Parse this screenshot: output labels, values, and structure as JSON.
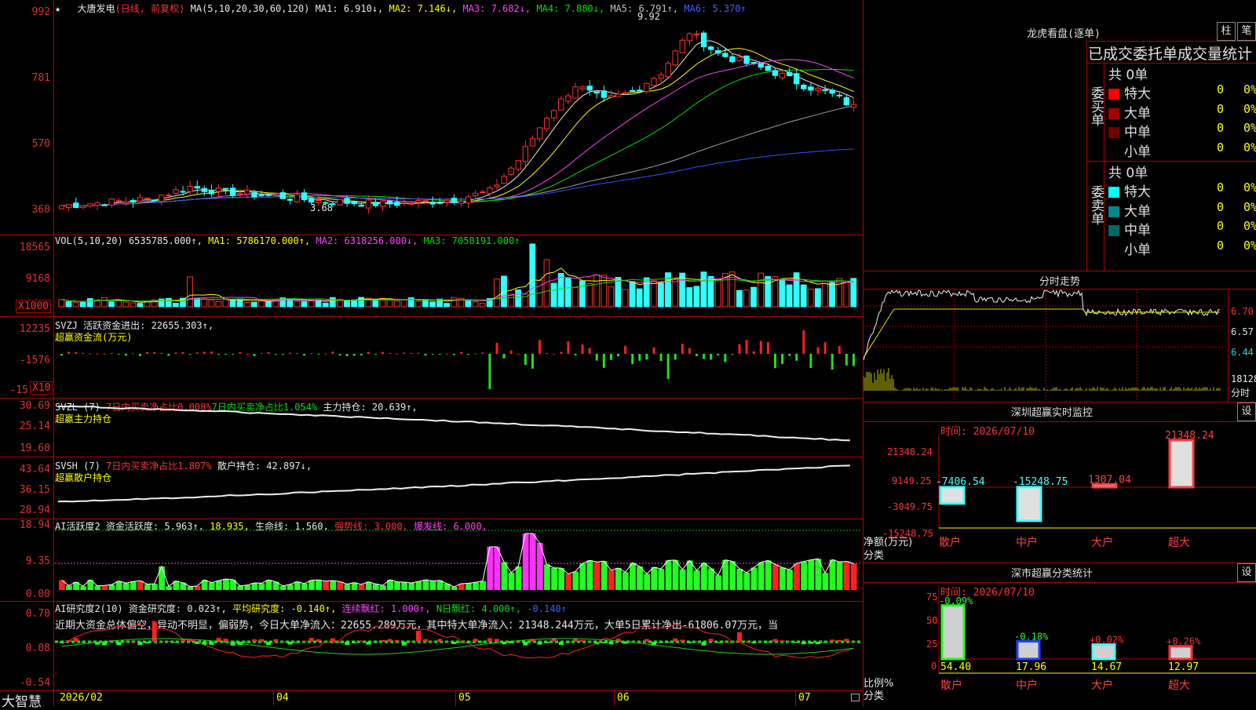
{
  "kline": {
    "title_star": "★",
    "stock_name": "大唐发电",
    "period": "(日线, 前复权)",
    "ma_header": "MA(5,10,20,30,60,120)",
    "ma1": "MA1: 6.910↓,",
    "ma2": "MA2: 7.146↓,",
    "ma3": "MA3: 7.682↓,",
    "ma4": "MA4: 7.880↓,",
    "ma5": "MA5: 6.791↑,",
    "ma6": "MA6: 5.370↑",
    "y_ticks": [
      "992",
      "781",
      "570",
      "360"
    ],
    "high_marker": "9.92",
    "low_marker": "3.68"
  },
  "volume": {
    "header": "VOL(5,10,20)",
    "value": "6535785.000↑,",
    "ma1": "MA1: 5786170.000↑,",
    "ma2": "MA2: 6318256.000↓,",
    "ma3": "MA3: 7058191.000↑",
    "y_ticks": [
      "18565",
      "9168"
    ],
    "unit": "X1000"
  },
  "svzj": {
    "line1": "SVZJ  活跃资金进出: 22655.303↑,",
    "line2": "超赢资金流(万元)",
    "y_ticks": [
      "12235",
      "-1576",
      "-15"
    ],
    "unit": "X10"
  },
  "svzl": {
    "header": "SVZL (7)",
    "seg1": "7日内买卖净占比0.008%",
    "seg2": "7日内买卖净占比1.054%",
    "seg3": "主力持仓: 20.639↑,",
    "line2": "超赢主力持仓",
    "y_ticks": [
      "30.69",
      "25.14",
      "19.60"
    ]
  },
  "svsh": {
    "header": "SVSH (7)",
    "seg1": "7日内买卖净占比1.807%",
    "seg2": "散户持仓: 42.897↓,",
    "line2": "超赢散户持仓",
    "y_ticks": [
      "43.64",
      "36.15",
      "28.94"
    ]
  },
  "ai_active": {
    "header": "AI活跃度2",
    "seg1": "资金活跃度: 5.963↑,",
    "seg2": "18.935,",
    "seg3": "生命线: 1.560,",
    "seg4": "强势线: 3.000,",
    "seg5": "爆发线: 6.000,",
    "y_ticks": [
      "18.94",
      "9.35",
      "0.00"
    ]
  },
  "ai_research": {
    "header": "AI研究度2(10)",
    "seg1": "资金研究度: 0.023↑,",
    "seg2": "平均研究度: -0.140↑,",
    "seg3": "连续飘红: 1.000↑,",
    "seg4": "N日飘红: 4.000↑,",
    "seg5": "-0.140↑",
    "summary": "近期大资金总体偏空，异动不明显，偏弱势，今日大单净流入：22655.289万元，其中特大单净流入：21348.244万元，大单5日累计净出-61806.07万元，当",
    "y_ticks": [
      "0.70",
      "0.08",
      "-0.54"
    ]
  },
  "bottom_axis": {
    "brand": "大智慧",
    "dates": [
      "2026/02",
      "04",
      "05",
      "06",
      "07"
    ]
  },
  "dragon_tiger": {
    "title": "龙虎看盘(逐单)",
    "btn1": "柱",
    "btn2": "笔",
    "subtitle": "已成交委托单成交量统计",
    "buy_label": "委买单",
    "sell_label": "委卖单",
    "buy_total": "共 0单",
    "sell_total": "共 0单",
    "buy_rows": [
      {
        "name": "特大",
        "count": "0",
        "pct": "0%",
        "color": "#ff0000"
      },
      {
        "name": "大单",
        "count": "0",
        "pct": "0%",
        "color": "#a00000"
      },
      {
        "name": "中单",
        "count": "0",
        "pct": "0%",
        "color": "#700000"
      },
      {
        "name": "小单",
        "count": "0",
        "pct": "0%",
        "color": "#000000"
      }
    ],
    "sell_rows": [
      {
        "name": "特大",
        "count": "0",
        "pct": "0%",
        "color": "#00ffff"
      },
      {
        "name": "大单",
        "count": "0",
        "pct": "0%",
        "color": "#008888"
      },
      {
        "name": "中单",
        "count": "0",
        "pct": "0%",
        "color": "#006666"
      },
      {
        "name": "小单",
        "count": "0",
        "pct": "0%",
        "color": "#000000"
      }
    ]
  },
  "intraday": {
    "title": "分时走势",
    "y_ticks": [
      "6.70",
      "6.57",
      "6.44"
    ],
    "vol_tick": "18128",
    "vol_label": "分时"
  },
  "monitor": {
    "title": "深圳超赢实时监控",
    "settings": "设",
    "time": "时间: 2026/07/10",
    "y_ticks": [
      "21348.24",
      "9149.25",
      "-3049.75",
      "-15248.75"
    ],
    "bars": [
      {
        "label": "散户",
        "value": "-7406.54"
      },
      {
        "label": "中户",
        "value": "-15248.75"
      },
      {
        "label": "大户",
        "value": "1307.04"
      },
      {
        "label": "超大",
        "value": "21348.24"
      }
    ],
    "y_title": "净额(万元)",
    "x_title": "分类"
  },
  "classify": {
    "title": "深市超赢分类统计",
    "settings": "设",
    "time": "时间: 2026/07/10",
    "y_ticks": [
      "75",
      "50",
      "25",
      "0"
    ],
    "bars": [
      {
        "label": "散户",
        "change": "-0.09%",
        "value": "54.40"
      },
      {
        "label": "中户",
        "change": "-0.18%",
        "value": "17.96"
      },
      {
        "label": "大户",
        "change": "+0.02%",
        "value": "14.67"
      },
      {
        "label": "超大",
        "change": "+0.26%",
        "value": "12.97"
      }
    ],
    "y_title": "比例%",
    "x_title": "分类"
  }
}
